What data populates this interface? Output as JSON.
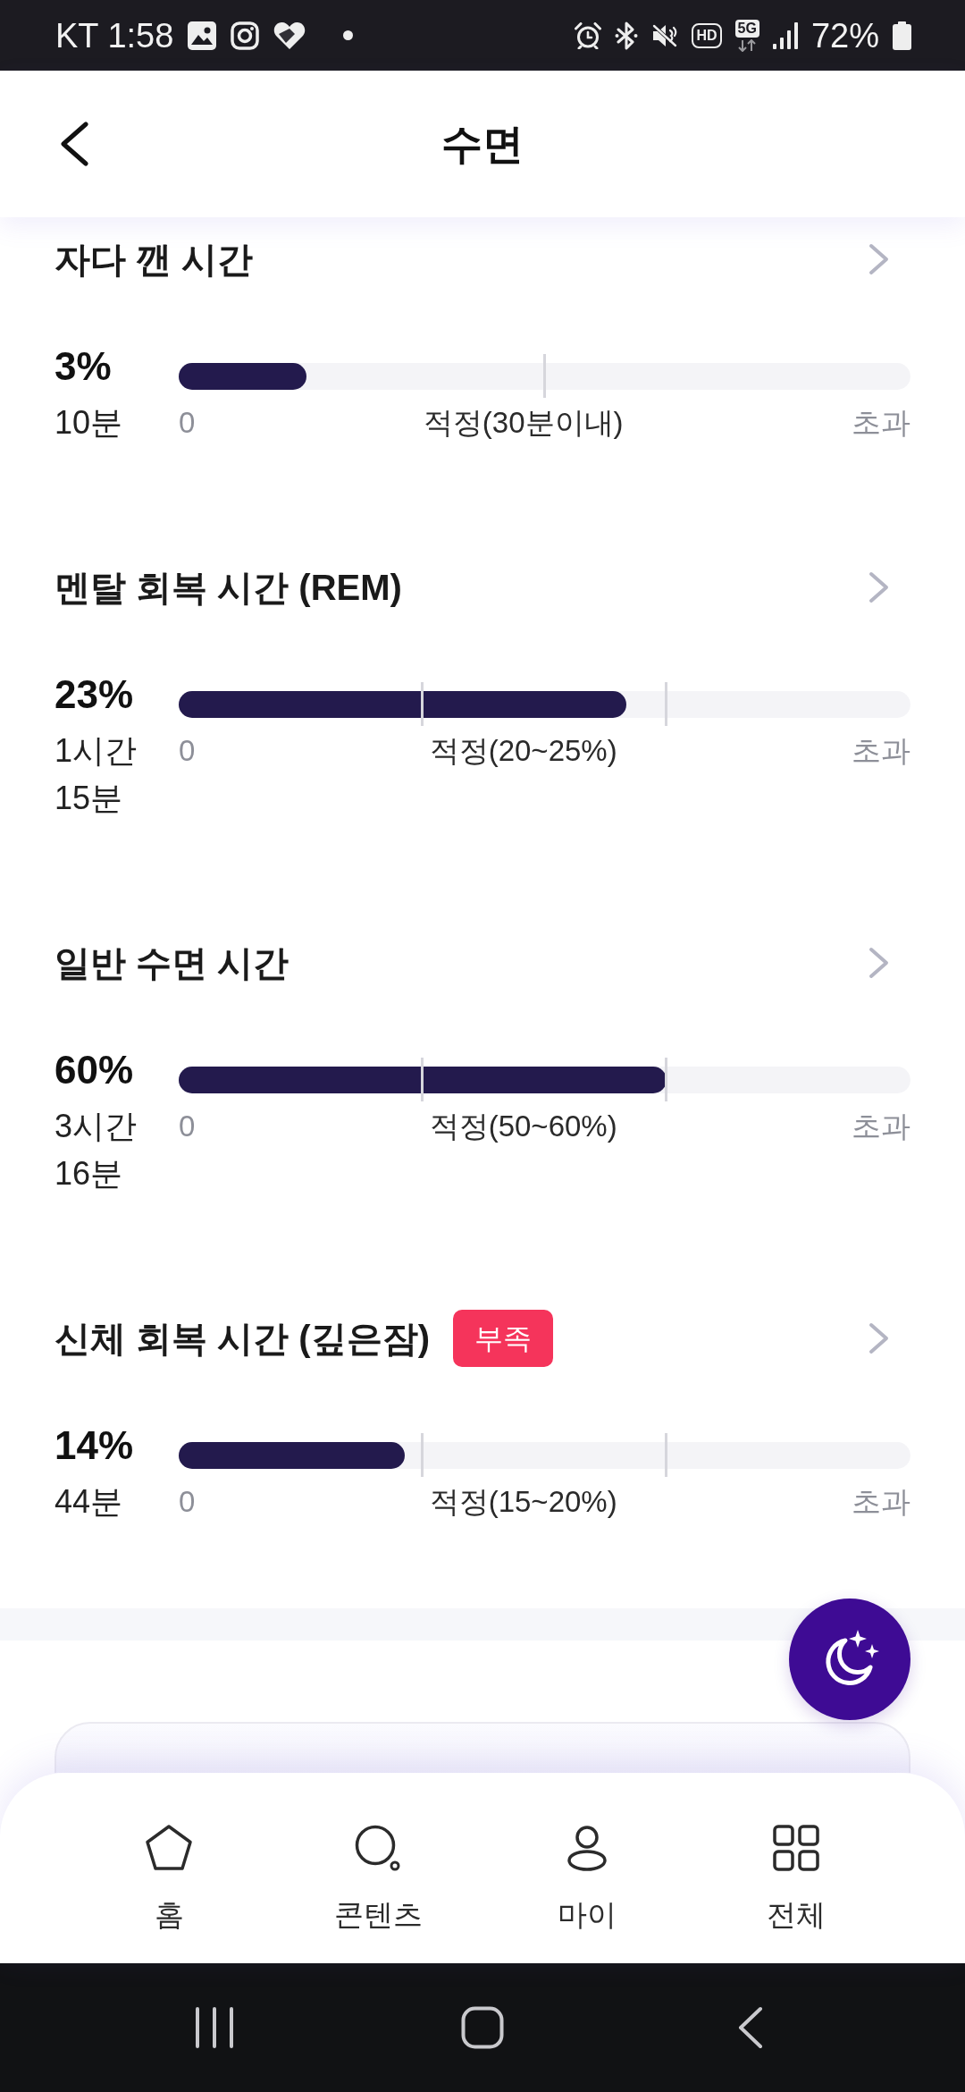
{
  "status_bar": {
    "time_text": "KT 1:58",
    "hd_label": "HD",
    "network_label": "5G",
    "battery_text": "72%"
  },
  "header": {
    "title": "수면"
  },
  "sections": [
    {
      "title": "자다 깬 시간",
      "kind": "limit",
      "percent": "3%",
      "duration": "10분",
      "level": 0.175,
      "scale_labels": [
        "0",
        "적정(30분이내)",
        "초과"
      ]
    },
    {
      "title": "멘탈 회복 시간 (REM)",
      "kind": "range",
      "percent": "23%",
      "duration": "1시간 15분",
      "level": 0.612,
      "scale_labels": [
        "0",
        "적정(20~25%)",
        "초과"
      ]
    },
    {
      "title": "일반 수면 시간",
      "kind": "range",
      "percent": "60%",
      "duration": "3시간 16분",
      "level": 0.667,
      "scale_labels": [
        "0",
        "적정(50~60%)",
        "초과"
      ]
    },
    {
      "title": "신체 회복 시간 (깊은잠)",
      "badge": "부족",
      "kind": "range",
      "percent": "14%",
      "duration": "44분",
      "level": 0.309,
      "scale_labels": [
        "0",
        "적정(15~20%)",
        "초과"
      ]
    }
  ],
  "bottom_nav": [
    {
      "kind": "home",
      "label": "홈",
      "selected": false
    },
    {
      "kind": "contents",
      "label": "콘텐츠",
      "selected": false
    },
    {
      "kind": "my",
      "label": "마이",
      "selected": false
    },
    {
      "kind": "all",
      "label": "전체",
      "selected": false
    }
  ]
}
